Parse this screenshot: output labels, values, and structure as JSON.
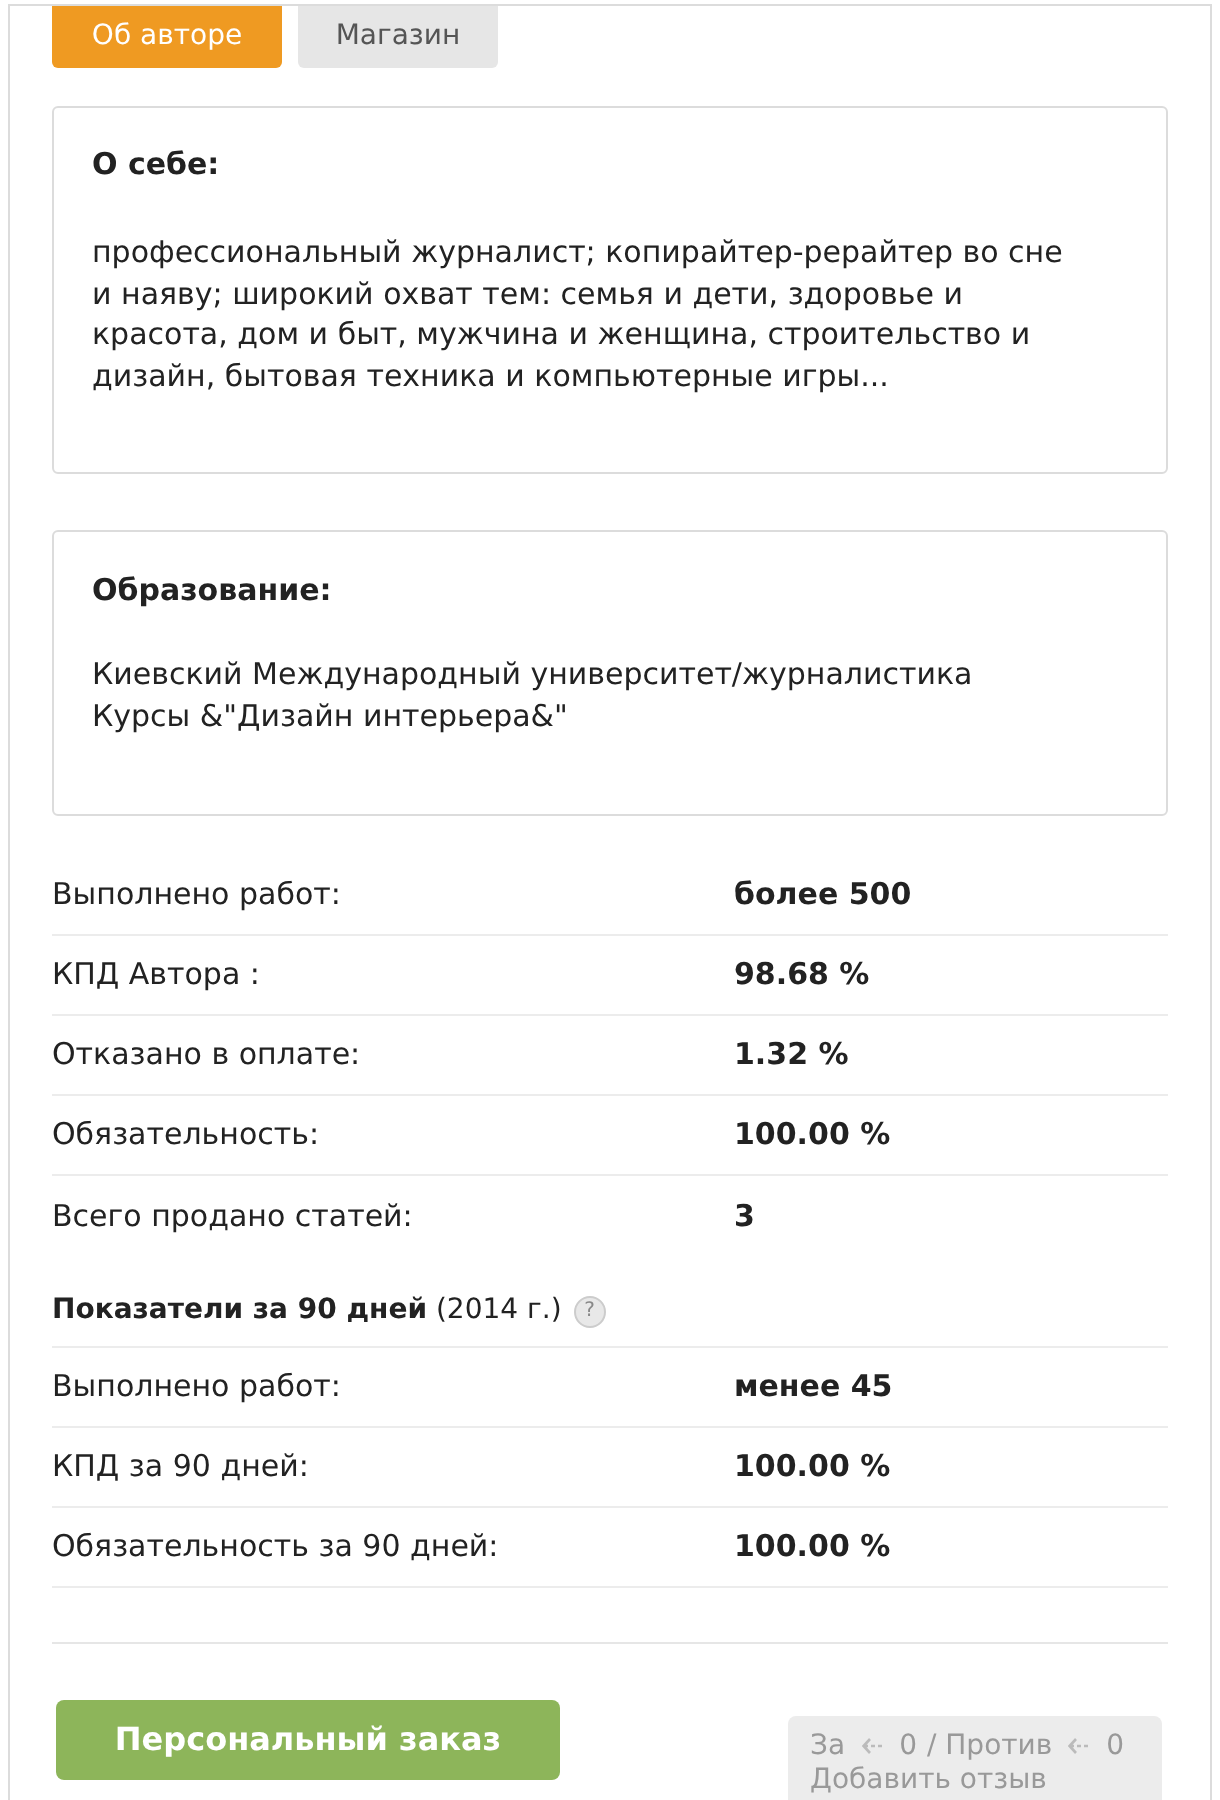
{
  "tabs": [
    {
      "label": "Об авторе",
      "selected": true
    },
    {
      "label": "Магазин",
      "selected": false
    }
  ],
  "about": {
    "title": "О себе:",
    "text": "профессиональный журналист; копирайтер-рерайтер во сне и наяву; широкий охват тем: семья и дети, здоровье и красота, дом и быт, мужчина и женщина, строительство и дизайн, бытовая техника и компьютерные игры..."
  },
  "education": {
    "title": "Образование:",
    "lines": [
      "Киевский Международный университет/журналистика",
      "Курсы &\"Дизайн интерьера&\""
    ]
  },
  "stats": [
    {
      "label": "Выполнено работ:",
      "value": "более 500"
    },
    {
      "label": "КПД Автора :",
      "value": "98.68 %"
    },
    {
      "label": "Отказано в оплате:",
      "value": "1.32 %"
    },
    {
      "label": "Обязательность:",
      "value": "100.00 %"
    },
    {
      "label": "Всего продано статей:",
      "value": "3"
    }
  ],
  "stats_90_days": {
    "title": "**Показатели за 90 дней** (2014 г.)",
    "help": "?",
    "rows": [
      {
        "label": "Выполнено работ:",
        "value": "менее 45"
      },
      {
        "label": "КПД за 90 дней:",
        "value": "100.00 %"
      },
      {
        "label": "Обязательность за 90 дней:",
        "value": "100.00 %"
      }
    ]
  },
  "order_button": "Персональный заказ",
  "votes": {
    "for_label": "За",
    "for_count": "0",
    "against_label": "/ Против",
    "against_count": "0",
    "add_review": "Добавить отзыв"
  }
}
